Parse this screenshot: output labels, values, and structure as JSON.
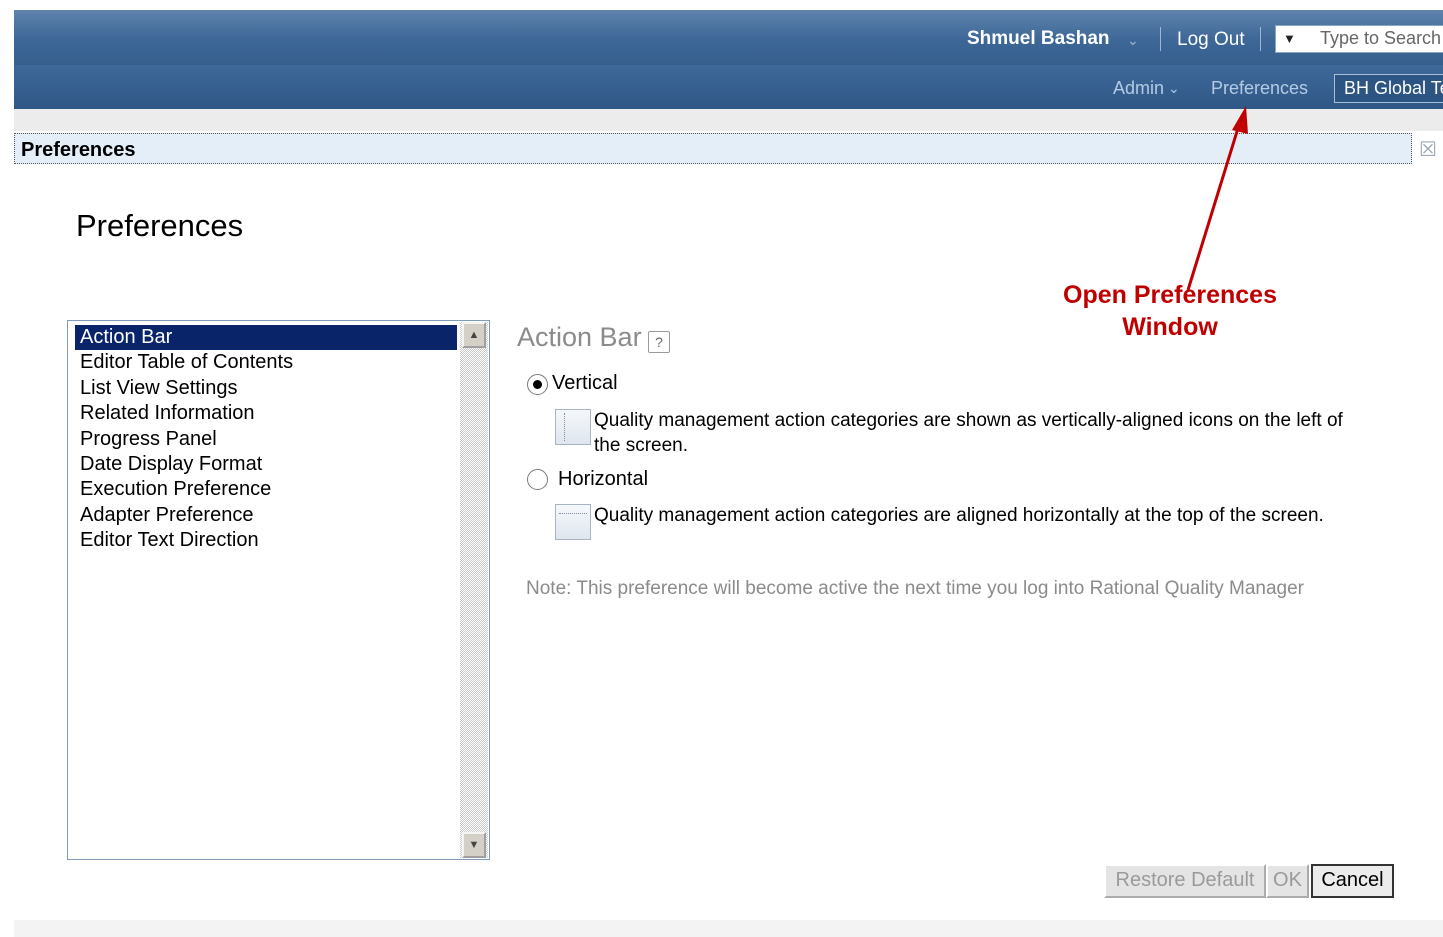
{
  "header": {
    "user_name": "Shmuel Bashan",
    "logout_label": "Log Out",
    "search_placeholder": "Type to Search",
    "admin_label": "Admin",
    "preferences_label": "Preferences",
    "project_label": "BH Global Test"
  },
  "dialog": {
    "title": "Preferences",
    "heading": "Preferences"
  },
  "categories": [
    "Action Bar",
    "Editor Table of Contents",
    "List View Settings",
    "Related Information",
    "Progress Panel",
    "Date Display Format",
    "Execution Preference",
    "Adapter Preference",
    "Editor Text Direction"
  ],
  "selected_category": "Action Bar",
  "panel": {
    "title": "Action Bar",
    "options": [
      {
        "label": "Vertical",
        "selected": true,
        "description": "Quality management action categories are shown as vertically-aligned icons on the left of the screen."
      },
      {
        "label": "Horizontal",
        "selected": false,
        "description": "Quality management action categories are aligned horizontally at the top of the screen."
      }
    ],
    "note": "Note: This preference will become active the next time you log into Rational Quality Manager"
  },
  "buttons": {
    "restore_default": "Restore Default",
    "ok": "OK",
    "cancel": "Cancel"
  },
  "annotation": {
    "line1": "Open Preferences",
    "line2": "Window",
    "color": "#c00000"
  }
}
